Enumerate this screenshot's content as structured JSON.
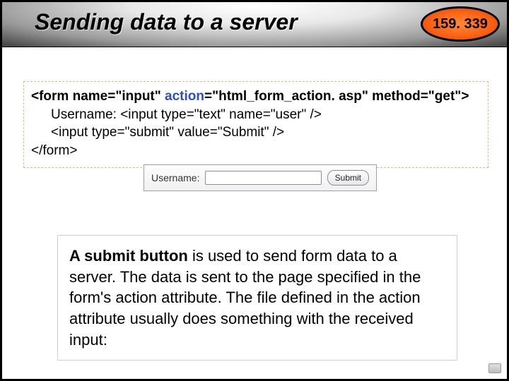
{
  "header": {
    "title": "Sending data to a server",
    "badge": "159. 339"
  },
  "code": {
    "line1_prefix": "<form name=\"input\" ",
    "line1_action_kw": "action",
    "line1_after_action": "=\"html_form_action. asp\" method=\"get\">",
    "line2": "Username: <input type=\"text\" name=\"user\" />",
    "line3": "<input type=\"submit\" value=\"Submit\" />",
    "line4": "</form>"
  },
  "preview": {
    "label": "Username:",
    "input_value": "",
    "button_label": "Submit"
  },
  "explanation": {
    "lead_strong": "A submit button",
    "rest": " is used to send form data to a server. The data is sent to the page specified in the form's action attribute. The file defined in the action attribute usually does something with the received input:"
  }
}
